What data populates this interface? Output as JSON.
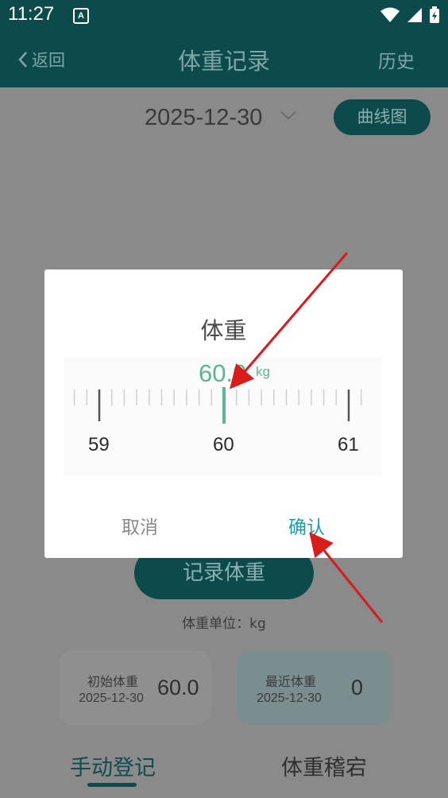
{
  "status": {
    "time": "11:27",
    "notif_letter": "A"
  },
  "nav": {
    "back_label": "返回",
    "title": "体重记录",
    "history_label": "历史"
  },
  "date": "2025-12-30",
  "curve_button": "曲线图",
  "record_button": "记录体重",
  "unit_label": "体重单位：kg",
  "cards": {
    "initial": {
      "label": "初始体重",
      "date": "2025-12-30",
      "value": "60.0"
    },
    "recent": {
      "label": "最近体重",
      "date": "2025-12-30",
      "value": "0"
    }
  },
  "tabs": {
    "manual": "手动登记",
    "trend": "体重稽宕"
  },
  "dialog": {
    "title": "体重",
    "value": "60.0",
    "unit": "kg",
    "ruler_labels": {
      "left": "59",
      "center": "60",
      "right": "61"
    },
    "cancel": "取消",
    "confirm": "确认"
  },
  "colors": {
    "teal_dark": "#0c4a4c",
    "accent_green": "#5bb596",
    "confirm_blue": "#1f9bb0",
    "arrow_red": "#d81b1b"
  }
}
